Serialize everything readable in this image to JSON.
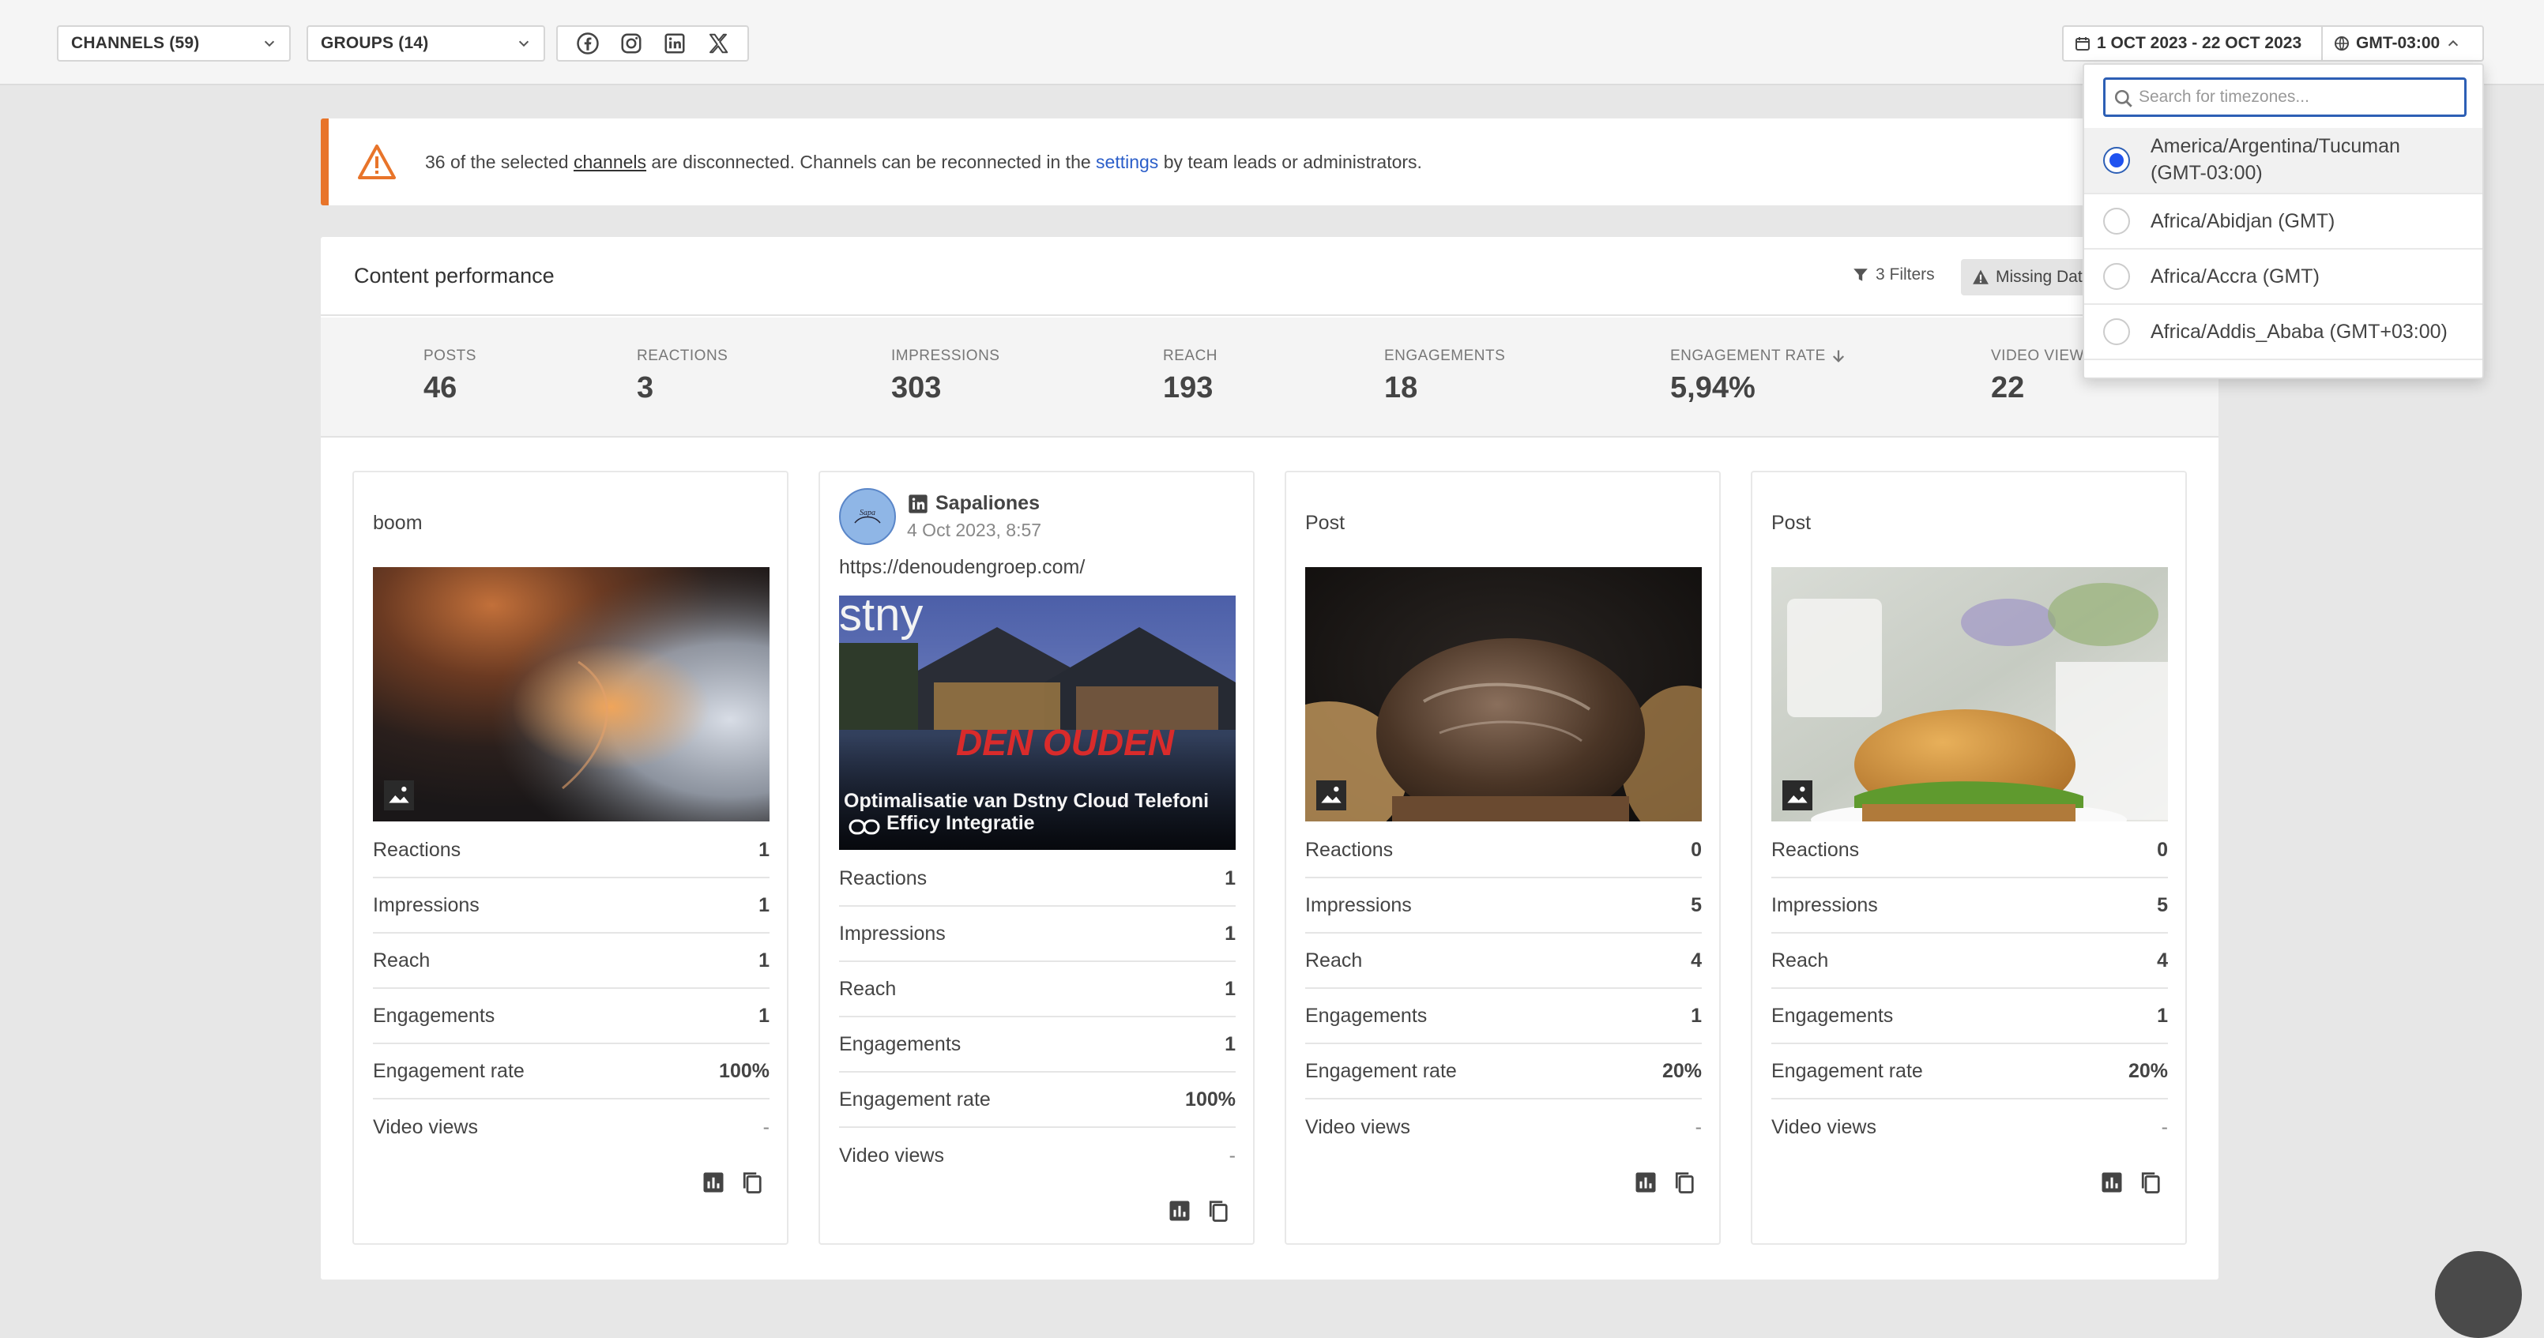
{
  "topbar": {
    "channels_label": "CHANNELS (59)",
    "groups_label": "GROUPS (14)",
    "date_range": "1 OCT 2023 - 22 OCT 2023",
    "timezone": "GMT-03:00"
  },
  "alert": {
    "prefix": "36 of the selected ",
    "link1": "channels",
    "middle": " are disconnected. Channels can be reconnected in the ",
    "link2": "settings",
    "suffix": " by team leads or administrators."
  },
  "panel": {
    "title": "Content performance",
    "filters_label": "3 Filters",
    "missing_label": "Missing Data"
  },
  "stats": [
    {
      "label": "POSTS",
      "value": "46"
    },
    {
      "label": "REACTIONS",
      "value": "3"
    },
    {
      "label": "IMPRESSIONS",
      "value": "303"
    },
    {
      "label": "REACH",
      "value": "193"
    },
    {
      "label": "ENGAGEMENTS",
      "value": "18"
    },
    {
      "label": "ENGAGEMENT RATE",
      "value": "5,94%"
    },
    {
      "label": "VIDEO VIEWS",
      "value": "22"
    }
  ],
  "metric_labels": {
    "reactions": "Reactions",
    "impressions": "Impressions",
    "reach": "Reach",
    "engagements": "Engagements",
    "engagement_rate": "Engagement rate",
    "video_views": "Video views"
  },
  "cards": [
    {
      "title": "boom",
      "reactions": "1",
      "impressions": "1",
      "reach": "1",
      "engagements": "1",
      "engagement_rate": "100%",
      "video_views": "-"
    },
    {
      "author": "Sapaliones",
      "date": "4 Oct 2023, 8:57",
      "url": "https://denoudengroep.com/",
      "preview_brand": "stny",
      "preview_sign": "DEN OUDEN",
      "preview_caption_1": "Optimalisatie van Dstny Cloud Telefoni",
      "preview_caption_2": "Efficy Integratie",
      "reactions": "1",
      "impressions": "1",
      "reach": "1",
      "engagements": "1",
      "engagement_rate": "100%",
      "video_views": "-"
    },
    {
      "title": "Post",
      "reactions": "0",
      "impressions": "5",
      "reach": "4",
      "engagements": "1",
      "engagement_rate": "20%",
      "video_views": "-"
    },
    {
      "title": "Post",
      "reactions": "0",
      "impressions": "5",
      "reach": "4",
      "engagements": "1",
      "engagement_rate": "20%",
      "video_views": "-"
    }
  ],
  "timezone_dropdown": {
    "search_placeholder": "Search for timezones...",
    "options": [
      {
        "line1": "America/Argentina/Tucuman",
        "line2": "(GMT-03:00)",
        "selected": true
      },
      {
        "line1": "Africa/Abidjan (GMT)",
        "selected": false
      },
      {
        "line1": "Africa/Accra (GMT)",
        "selected": false
      },
      {
        "line1": "Africa/Addis_Ababa (GMT+03:00)",
        "selected": false
      }
    ]
  },
  "colors": {
    "accent_blue": "#2d5fb5",
    "warning_orange": "#e8742a",
    "link_blue": "#2b5ec9"
  }
}
